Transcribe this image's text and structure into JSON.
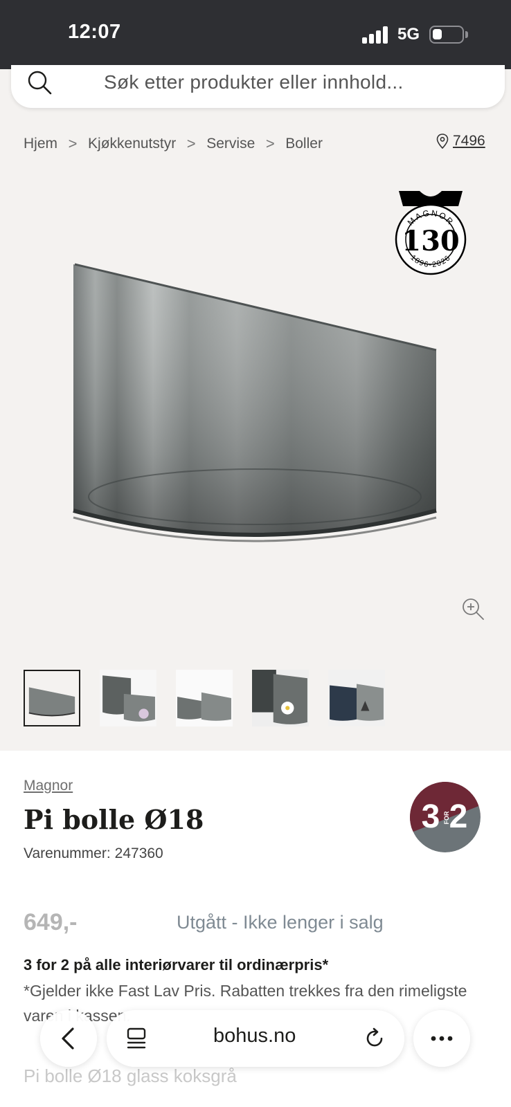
{
  "status_bar": {
    "time": "12:07",
    "network": "5G"
  },
  "search": {
    "placeholder": "Søk etter produkter eller innhold..."
  },
  "breadcrumb": {
    "items": [
      "Hjem",
      "Kjøkkenutstyr",
      "Servise",
      "Boller"
    ],
    "separator": ">"
  },
  "store": {
    "label": "7496",
    "icon": "location-pin-icon"
  },
  "anniversary_badge": {
    "brand": "MAGNOR",
    "number": "130",
    "years": "1896-2026"
  },
  "gallery": {
    "thumbnail_count": 5,
    "active_index": 0
  },
  "product": {
    "brand": "Magnor",
    "title": "Pi bolle Ø18",
    "sku_label": "Varenummer:",
    "sku": "247360",
    "price": "649,-",
    "availability": "Utgått - Ikke lenger i salg",
    "subtitle": "Pi bolle Ø18 glass koksgrå"
  },
  "promo_badge": {
    "left": "3",
    "small": "FOR",
    "right": "2",
    "colors": {
      "top": "#6e2836",
      "bottom": "#6c7478"
    }
  },
  "offer": {
    "title": "3 for 2 på alle interiørvarer til ordinærpris*",
    "description": "*Gjelder ikke Fast Lav Pris. Rabatten trekkes fra den rimeligste varen i kassen."
  },
  "browser": {
    "url": "bohus.no"
  },
  "colors": {
    "status_bar": "#2e2f33",
    "product_background": "#f4f2f0",
    "availability": "#7f8a93",
    "price_inactive": "#b5b5b5"
  }
}
